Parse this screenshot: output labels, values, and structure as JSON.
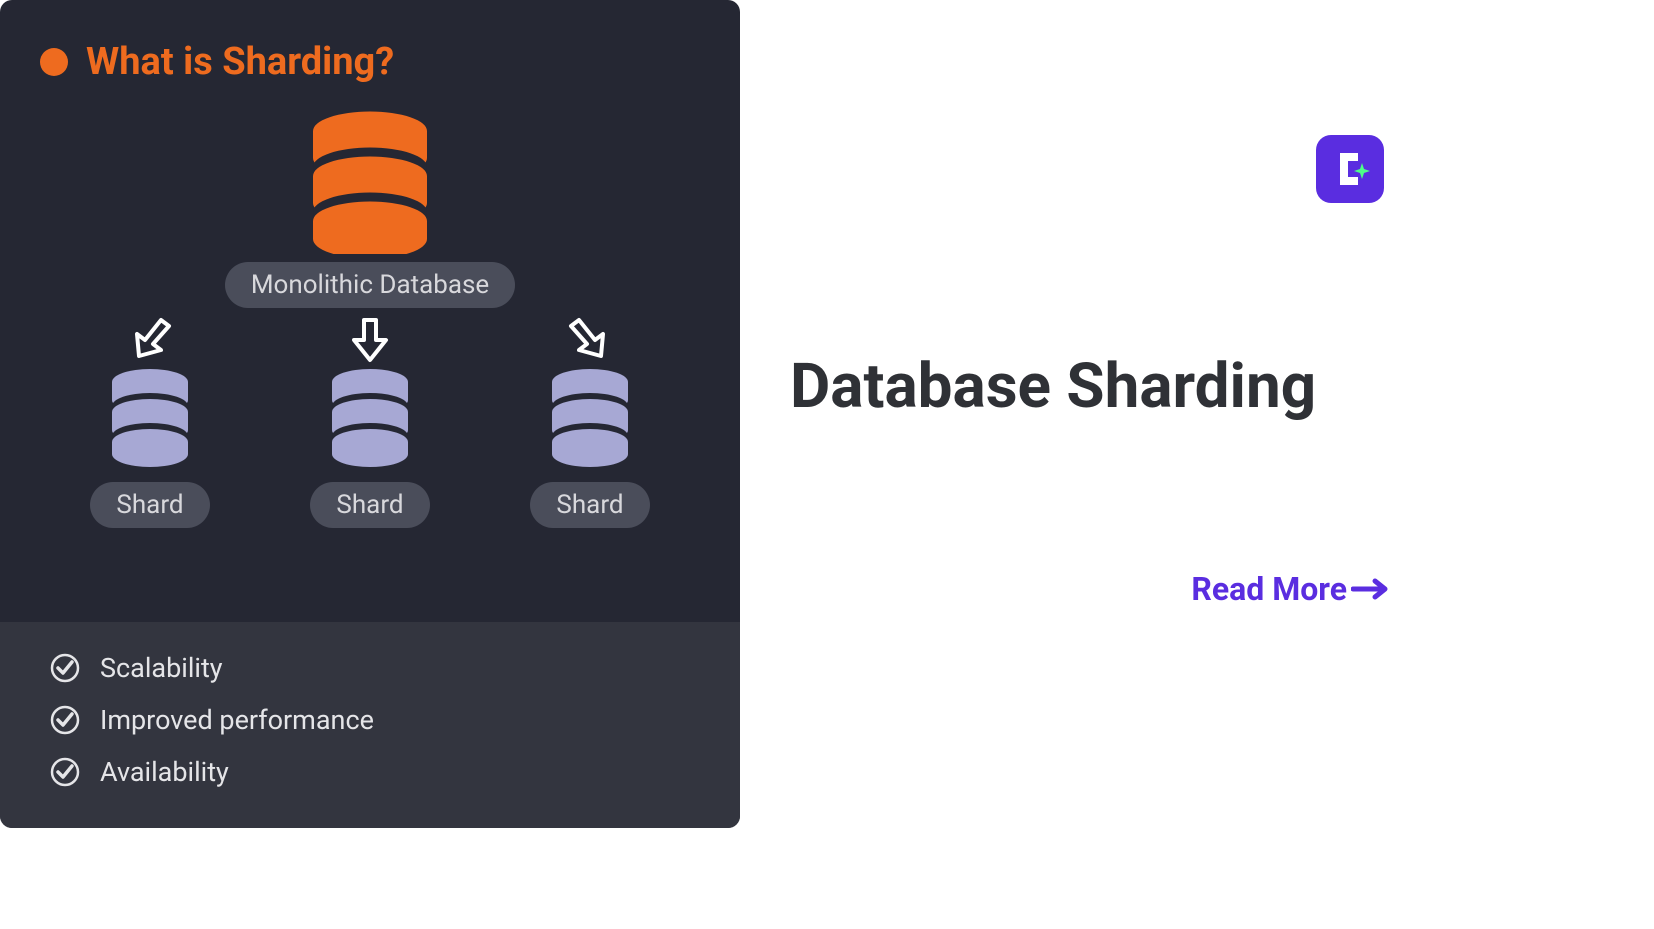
{
  "left": {
    "heading": "What is Sharding?",
    "mono_label": "Monolithic Database",
    "shard_label": "Shard",
    "benefits": [
      "Scalability",
      "Improved performance",
      "Availability"
    ]
  },
  "right": {
    "title": "Database Sharding",
    "cta": "Read More"
  },
  "colors": {
    "accent_orange": "#ee6b1f",
    "shard_purple": "#a7a8d4",
    "brand_purple": "#5a2de0",
    "brand_green": "#4dff88"
  }
}
